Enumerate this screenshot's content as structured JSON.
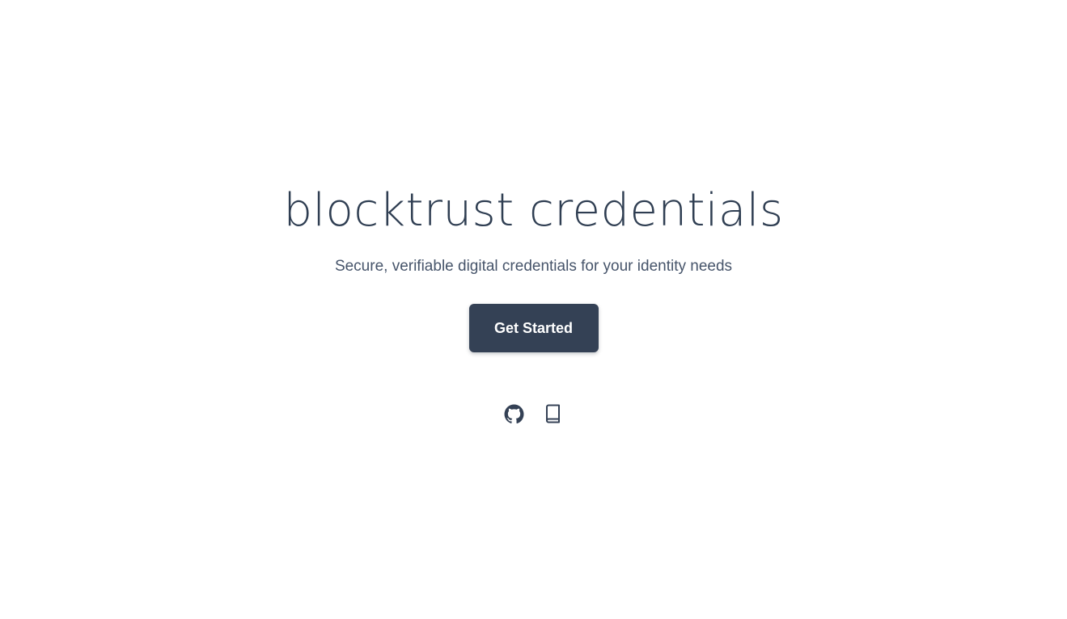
{
  "hero": {
    "title": "blocktrust credentials",
    "subtitle": "Secure, verifiable digital credentials for your identity needs",
    "cta_label": "Get Started"
  },
  "links": [
    {
      "icon": "github-icon"
    },
    {
      "icon": "book-icon"
    }
  ],
  "colors": {
    "text_primary": "#2f3e52",
    "text_secondary": "#46546a",
    "button_bg": "#344155",
    "button_text": "#ffffff",
    "background": "#ffffff"
  }
}
